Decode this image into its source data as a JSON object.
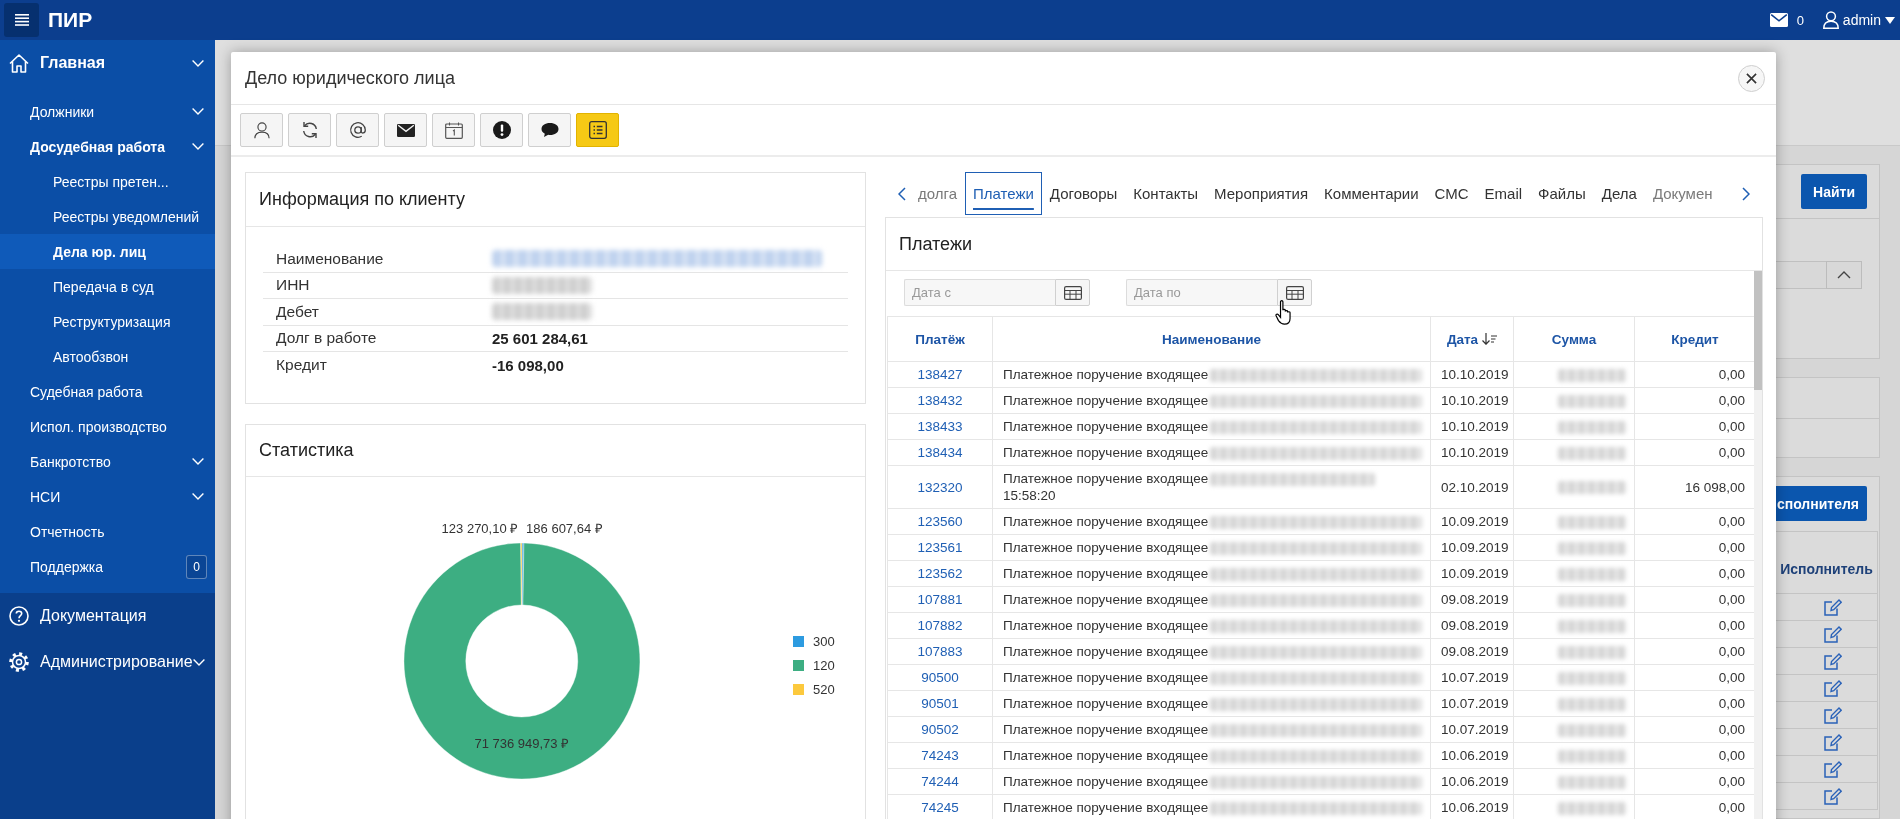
{
  "top_bar": {
    "app_title": "ПИР",
    "messages_count": "0",
    "user": "admin"
  },
  "sidebar": {
    "items": [
      {
        "label": "Главная",
        "kind": "home",
        "expandable": true,
        "selected": false,
        "children": [
          {
            "label": "Должники",
            "expandable": true,
            "selected": false
          },
          {
            "label": "Досудебная работа",
            "expandable": true,
            "selected": false,
            "children": [
              {
                "label": "Реестры претен...",
                "expandable": false,
                "selected": false
              },
              {
                "label": "Реестры уведомлений",
                "expandable": false,
                "selected": false
              },
              {
                "label": "Дела юр. лиц",
                "expandable": false,
                "selected": true
              },
              {
                "label": "Передача в суд",
                "expandable": false,
                "selected": false
              },
              {
                "label": "Реструктуризация",
                "expandable": false,
                "selected": false
              },
              {
                "label": "Автообзвон",
                "expandable": false,
                "selected": false
              }
            ]
          },
          {
            "label": "Судебная работа",
            "expandable": false,
            "selected": false
          },
          {
            "label": "Испол. производство",
            "expandable": false,
            "selected": false
          },
          {
            "label": "Банкротство",
            "expandable": true,
            "selected": false
          },
          {
            "label": "НСИ",
            "expandable": true,
            "selected": false
          },
          {
            "label": "Отчетность",
            "expandable": false,
            "selected": false
          },
          {
            "label": "Поддержка",
            "expandable": false,
            "selected": false,
            "badge": "0"
          }
        ]
      },
      {
        "label": "Документация",
        "kind": "help",
        "expandable": false,
        "selected": false
      },
      {
        "label": "Администрирование",
        "kind": "settings",
        "expandable": true,
        "selected": false
      }
    ]
  },
  "background_page": {
    "search_button": "Найти",
    "assign_button": "сполнителя",
    "table": {
      "column": "Исполнитель",
      "rows": [
        {
          "editable": true
        },
        {
          "editable": true
        },
        {
          "editable": true
        },
        {
          "editable": true
        },
        {
          "editable": true
        },
        {
          "editable": true
        },
        {
          "editable": true
        },
        {
          "editable": true
        }
      ]
    }
  },
  "modal": {
    "title": "Дело юридического лица",
    "toolbar": [
      {
        "kind": "person",
        "selected": false
      },
      {
        "kind": "refresh",
        "selected": false
      },
      {
        "kind": "at",
        "selected": false
      },
      {
        "kind": "mail",
        "selected": false
      },
      {
        "kind": "calendar",
        "selected": false
      },
      {
        "kind": "alert",
        "selected": false
      },
      {
        "kind": "comment",
        "selected": false
      },
      {
        "kind": "list",
        "selected": true
      }
    ],
    "client_info": {
      "title": "Информация по клиенту",
      "rows": [
        {
          "label": "Наименование",
          "kind": "blurred_link"
        },
        {
          "label": "ИНН",
          "kind": "blurred"
        },
        {
          "label": "Дебет",
          "kind": "blurred"
        },
        {
          "label": "Долг в работе",
          "kind": "amount",
          "value": "25 601 284,61"
        },
        {
          "label": "Кредит",
          "kind": "amount",
          "value": "-16 098,00"
        }
      ]
    },
    "statistics": {
      "title": "Статистика",
      "chart_data": {
        "type": "donut",
        "categories": [
          "300",
          "120",
          "520"
        ],
        "values": [
          186607.64,
          71736949.73,
          123270.1
        ],
        "colors": [
          "#2d9be0",
          "#3dae82",
          "#fcc93d"
        ],
        "value_labels": [
          "186 607,64 ₽",
          "71 736 949,73 ₽",
          "123 270,10 ₽"
        ],
        "legend": "right"
      }
    },
    "tabs": [
      {
        "label": "долга",
        "selected": false
      },
      {
        "label": "Платежи",
        "selected": true
      },
      {
        "label": "Договоры",
        "selected": false
      },
      {
        "label": "Контакты",
        "selected": false
      },
      {
        "label": "Мероприятия",
        "selected": false
      },
      {
        "label": "Комментарии",
        "selected": false
      },
      {
        "label": "СМС",
        "selected": false
      },
      {
        "label": "Email",
        "selected": false
      },
      {
        "label": "Файлы",
        "selected": false
      },
      {
        "label": "Дела",
        "selected": false
      },
      {
        "label": "Докумен",
        "selected": false
      }
    ],
    "payments": {
      "title": "Платежи",
      "filters": [
        {
          "placeholder": "Дата с",
          "hovered": false
        },
        {
          "placeholder": "Дата по",
          "hovered": true
        }
      ],
      "table": {
        "columns": [
          {
            "label": "Платёж",
            "sorted": false
          },
          {
            "label": "Наименование",
            "sorted": false
          },
          {
            "label": "Дата",
            "sorted": true
          },
          {
            "label": "Сумма",
            "sorted": false
          },
          {
            "label": "Кредит",
            "sorted": false
          }
        ],
        "rows": [
          {
            "payment": "138427",
            "name": "Платежное поручение входящее",
            "date": "10.10.2019",
            "credit": "0,00"
          },
          {
            "payment": "138432",
            "name": "Платежное поручение входящее",
            "date": "10.10.2019",
            "credit": "0,00"
          },
          {
            "payment": "138433",
            "name": "Платежное поручение входящее",
            "date": "10.10.2019",
            "credit": "0,00"
          },
          {
            "payment": "138434",
            "name": "Платежное поручение входящее",
            "date": "10.10.2019",
            "credit": "0,00"
          },
          {
            "payment": "132320",
            "name": "Платежное поручение входящее",
            "name_tail": "15:58:20",
            "date": "02.10.2019",
            "credit": "16 098,00"
          },
          {
            "payment": "123560",
            "name": "Платежное поручение входящее",
            "date": "10.09.2019",
            "credit": "0,00"
          },
          {
            "payment": "123561",
            "name": "Платежное поручение входящее",
            "date": "10.09.2019",
            "credit": "0,00"
          },
          {
            "payment": "123562",
            "name": "Платежное поручение входящее",
            "date": "10.09.2019",
            "credit": "0,00"
          },
          {
            "payment": "107881",
            "name": "Платежное поручение входящее",
            "date": "09.08.2019",
            "credit": "0,00"
          },
          {
            "payment": "107882",
            "name": "Платежное поручение входящее",
            "date": "09.08.2019",
            "credit": "0,00"
          },
          {
            "payment": "107883",
            "name": "Платежное поручение входящее",
            "date": "09.08.2019",
            "credit": "0,00"
          },
          {
            "payment": "90500",
            "name": "Платежное поручение входящее",
            "date": "10.07.2019",
            "credit": "0,00"
          },
          {
            "payment": "90501",
            "name": "Платежное поручение входящее",
            "date": "10.07.2019",
            "credit": "0,00"
          },
          {
            "payment": "90502",
            "name": "Платежное поручение входящее",
            "date": "10.07.2019",
            "credit": "0,00"
          },
          {
            "payment": "74243",
            "name": "Платежное поручение входящее",
            "date": "10.06.2019",
            "credit": "0,00"
          },
          {
            "payment": "74244",
            "name": "Платежное поручение входящее",
            "date": "10.06.2019",
            "credit": "0,00"
          },
          {
            "payment": "74245",
            "name": "Платежное поручение входящее",
            "date": "10.06.2019",
            "credit": "0,00"
          }
        ]
      }
    }
  }
}
